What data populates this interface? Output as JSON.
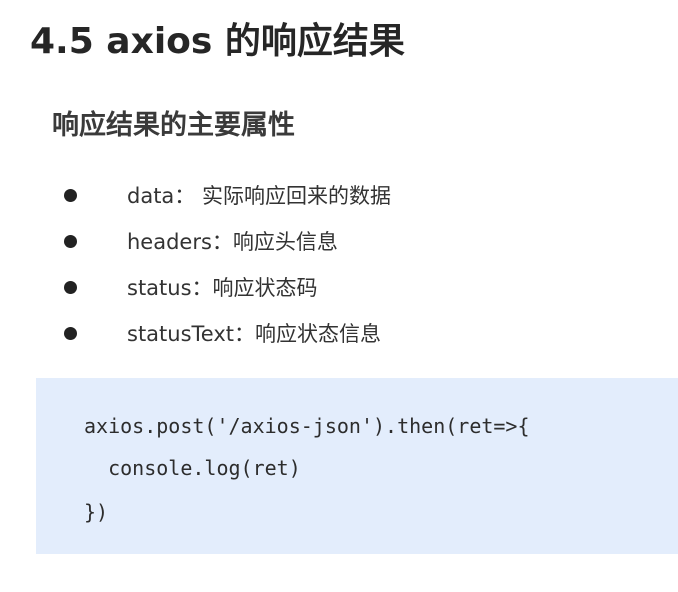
{
  "title": "4.5 axios 的响应结果",
  "section": {
    "heading": "响应结果的主要属性"
  },
  "attributes": [
    "data： 实际响应回来的数据",
    "headers：响应头信息",
    "status：响应状态码",
    "statusText：响应状态信息"
  ],
  "code": {
    "lines": [
      "axios.post('/axios-json').then(ret=>{",
      "  console.log(ret)",
      "})"
    ]
  },
  "colors": {
    "code_background": "#e3edfc",
    "text": "#2b2b2b"
  }
}
